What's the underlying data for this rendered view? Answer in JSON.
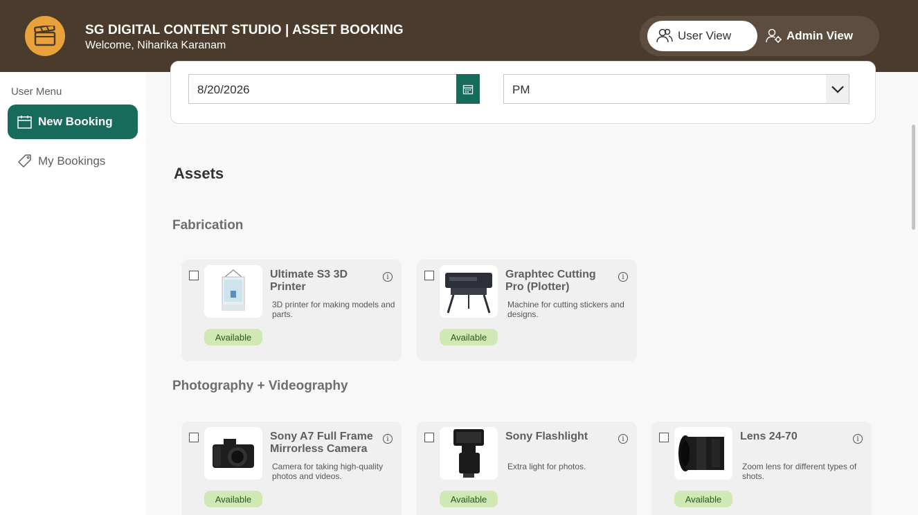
{
  "header": {
    "title": "SG DIGITAL CONTENT STUDIO | ASSET BOOKING",
    "welcome": "Welcome, Niharika Karanam",
    "logo_icon": "clapperboard-icon",
    "user_view_label": "User View",
    "admin_view_label": "Admin View"
  },
  "sidebar": {
    "heading": "User Menu",
    "items": [
      {
        "label": "New Booking",
        "icon": "calendar-icon",
        "active": true
      },
      {
        "label": "My Bookings",
        "icon": "tag-icon",
        "active": false
      }
    ]
  },
  "form": {
    "date_value": "8/20/2026",
    "session_value": "PM"
  },
  "assets": {
    "title": "Assets",
    "categories": [
      {
        "name": "Fabrication",
        "items": [
          {
            "name": "Ultimate S3 3D Printer",
            "description": "3D printer for making models and parts.",
            "status": "Available"
          },
          {
            "name": "Graphtec Cutting Pro (Plotter)",
            "description": "Machine for cutting stickers and designs.",
            "status": "Available"
          }
        ]
      },
      {
        "name": "Photography + Videography",
        "items": [
          {
            "name": "Sony A7 Full Frame Mirrorless Camera",
            "description": "Camera for taking high-quality photos and videos.",
            "status": "Available"
          },
          {
            "name": "Sony Flashlight",
            "description": "Extra light for photos.",
            "status": "Available"
          },
          {
            "name": "Lens 24-70",
            "description": "Zoom lens for different types of shots.",
            "status": "Available"
          }
        ]
      }
    ]
  },
  "colors": {
    "header_bg": "#4a3b2c",
    "logo_accent": "#e9a23b",
    "primary_green": "#176b5b",
    "badge_bg": "#cfe8b4"
  }
}
